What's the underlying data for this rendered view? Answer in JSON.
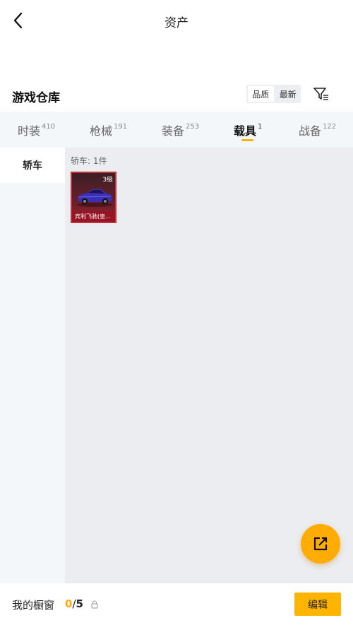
{
  "header": {
    "title": "资产"
  },
  "section": {
    "title": "游戏仓库",
    "sort_options": [
      "品质",
      "最新"
    ]
  },
  "tabs": [
    {
      "label": "时装",
      "count": "410"
    },
    {
      "label": "枪械",
      "count": "191"
    },
    {
      "label": "装备",
      "count": "253"
    },
    {
      "label": "载具",
      "count": "1"
    },
    {
      "label": "战备",
      "count": "122"
    }
  ],
  "active_tab": "载具",
  "sidebar": {
    "items": [
      {
        "label": "轿车"
      }
    ]
  },
  "content": {
    "group_label": "轿车: 1件",
    "items": [
      {
        "level": "3级",
        "name": "宾利飞驰(皇..."
      }
    ]
  },
  "bottom": {
    "window_label": "我的橱窗",
    "current": "0",
    "separator": "/",
    "max": "5",
    "edit_label": "编辑"
  },
  "colors": {
    "accent": "#ffb400",
    "item_border": "#c8303a"
  },
  "icons": {
    "back": "chevron-left-icon",
    "filter": "filter-icon",
    "share": "external-link-icon",
    "lock": "lock-icon"
  }
}
